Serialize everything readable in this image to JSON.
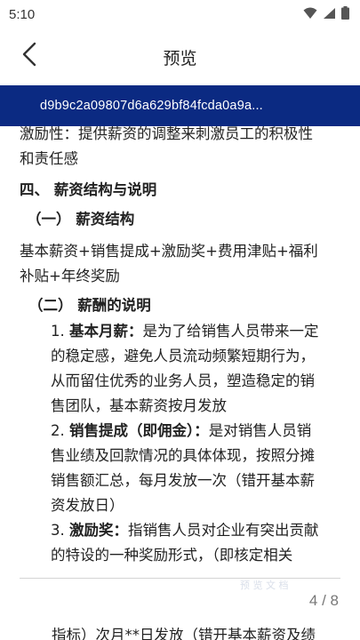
{
  "status_bar": {
    "time": "5:10",
    "icons": [
      "wifi-icon",
      "signal-icon",
      "battery-icon"
    ]
  },
  "app_bar": {
    "title": "预览",
    "back_icon": "chevron-left-icon"
  },
  "banner": {
    "hash": "d9b9c2a09807d6a629bf84fcda0a9a...",
    "bg_color": "#0b2a82"
  },
  "document": {
    "lines": [
      "激励性：提供薪资的调整来刺激员工的积极性",
      "和责任感",
      "四、 薪资结构与说明",
      "（一） 薪资结构",
      "基本薪资+销售提成+激励奖+费用津贴+福利",
      "补贴+年终奖励",
      "（二） 薪酬的说明",
      "1. ",
      "基本月薪：",
      "是为了给销售人员带来一定",
      "的稳定感，避免人员流动频繁短期行为，",
      "从而留住优秀的业务人员，塑造稳定的销",
      "售团队，基本薪资按月发放",
      "2. ",
      "销售提成（即佣金）：",
      "是对销售人员销",
      "售业绩及回款情况的具体体现，按照分摊",
      "销售额汇总，每月发放一次（错开基本薪",
      "资发放日）",
      "3. ",
      "激励奖：",
      "指销售人员对企业有突出贡献",
      "的特设的一种奖励形式，（即核定相关"
    ],
    "next_page_line": "指标）次月**日发放（错开基本薪资及绩"
  },
  "pager": {
    "indicator": "4 / 8",
    "watermark": "预 览 文 档"
  }
}
